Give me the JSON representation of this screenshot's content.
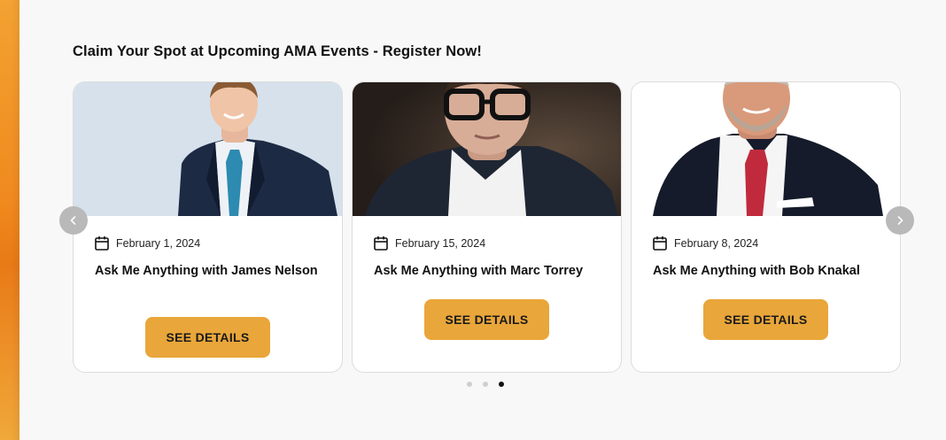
{
  "section": {
    "heading": "Claim Your Spot at Upcoming AMA Events - Register Now!"
  },
  "carousel": {
    "prev_icon": "chevron-left-icon",
    "next_icon": "chevron-right-icon",
    "active_page": 3,
    "page_count": 3,
    "cards": [
      {
        "date": "February 1, 2024",
        "title": "Ask Me Anything with James Nelson",
        "button": "SEE DETAILS",
        "photo_bg": "#d6e1ec"
      },
      {
        "date": "February 15, 2024",
        "title": "Ask Me Anything with Marc Torrey",
        "button": "SEE DETAILS",
        "photo_bg": "#3a2f28"
      },
      {
        "date": "February 8, 2024",
        "title": "Ask Me Anything with Bob Knakal",
        "button": "SEE DETAILS",
        "photo_bg": "#ffffff"
      }
    ]
  },
  "colors": {
    "accent": "#e9a63a",
    "side_strip": "#f08a1e",
    "arrow_bg": "#b9b9b9"
  }
}
